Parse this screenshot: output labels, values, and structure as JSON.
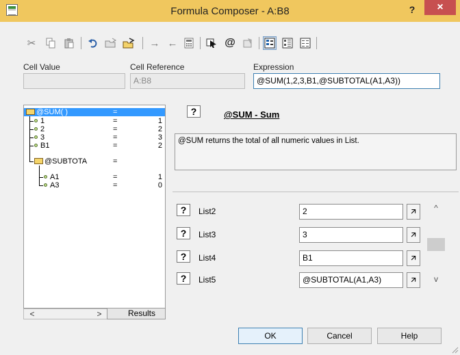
{
  "window": {
    "title": "Formula Composer - A:B8",
    "help_label": "?",
    "close_label": "×"
  },
  "toolbar": {
    "icons": [
      "scissors-icon",
      "copy-icon",
      "paste-icon",
      "undo-icon",
      "open-icon",
      "save-icon",
      "arrow-right-icon",
      "arrow-left-icon",
      "calculator-icon",
      "pick-cell-icon",
      "at-function-icon",
      "object-icon",
      "tree-view-icon",
      "list-view-icon",
      "grid-view-icon"
    ]
  },
  "fields": {
    "cell_value": {
      "label": "Cell Value",
      "value": ""
    },
    "cell_reference": {
      "label": "Cell Reference",
      "value": "A:B8"
    },
    "expression": {
      "label": "Expression",
      "value": "@SUM(1,2,3,B1,@SUBTOTAL(A1,A3))"
    }
  },
  "tree": {
    "rows": [
      {
        "name": "@SUM( )",
        "eq": "=",
        "value": "",
        "type": "folder",
        "selected": true
      },
      {
        "name": "1",
        "eq": "=",
        "value": "1",
        "type": "leaf"
      },
      {
        "name": "2",
        "eq": "=",
        "value": "2",
        "type": "leaf"
      },
      {
        "name": "3",
        "eq": "=",
        "value": "3",
        "type": "leaf"
      },
      {
        "name": "B1",
        "eq": "=",
        "value": "2",
        "type": "leaf"
      },
      {
        "name": "@SUBTOTA",
        "eq": "=",
        "value": "",
        "type": "folder"
      },
      {
        "name": "A1",
        "eq": "=",
        "value": "1",
        "type": "leaf"
      },
      {
        "name": "A3",
        "eq": "=",
        "value": "0",
        "type": "leaf"
      }
    ],
    "scroll_left": "<",
    "scroll_right": ">",
    "results_tab": "Results"
  },
  "function": {
    "help_label": "?",
    "title": "@SUM - Sum",
    "description": "@SUM returns the total of all numeric values in List."
  },
  "arguments": [
    {
      "label": "List2",
      "value": "2"
    },
    {
      "label": "List3",
      "value": "3"
    },
    {
      "label": "List4",
      "value": "B1"
    },
    {
      "label": "List5",
      "value": "@SUBTOTAL(A1,A3)"
    }
  ],
  "scroll": {
    "up": "^",
    "down": "v"
  },
  "buttons": {
    "ok": "OK",
    "cancel": "Cancel",
    "help": "Help"
  },
  "colors": {
    "titlebar": "#f0c75e",
    "close": "#c75050",
    "selection": "#3399ff"
  }
}
